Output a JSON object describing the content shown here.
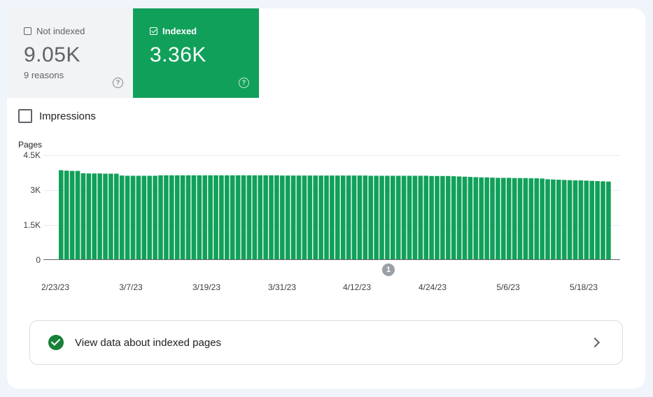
{
  "tiles": {
    "not_indexed": {
      "label": "Not indexed",
      "value": "9.05K",
      "sub": "9 reasons",
      "checked": false,
      "help": "?"
    },
    "indexed": {
      "label": "Indexed",
      "value": "3.36K",
      "checked": true,
      "help": "?"
    }
  },
  "impressions": {
    "label": "Impressions",
    "checked": false
  },
  "colors": {
    "indexed": "#11a05a",
    "bars": "#11a05a",
    "not_indexed_bg": "#f1f3f4",
    "page_bg": "#f0f4fb"
  },
  "chart_data": {
    "type": "bar",
    "ylabel": "Pages",
    "ylim": [
      0,
      4500
    ],
    "yticks": [
      "4.5K",
      "3K",
      "1.5K",
      "0"
    ],
    "yvalues": [
      4500,
      3000,
      1500,
      0
    ],
    "xticks": [
      "2/23/23",
      "3/7/23",
      "3/19/23",
      "3/31/23",
      "4/12/23",
      "4/24/23",
      "5/6/23",
      "5/18/23"
    ],
    "start_date": "2/23/23",
    "grid": true,
    "annotation": {
      "label": "1",
      "date": "4/14/23"
    },
    "values": [
      3850,
      3830,
      3820,
      3820,
      3720,
      3710,
      3710,
      3710,
      3700,
      3700,
      3700,
      3620,
      3610,
      3610,
      3610,
      3610,
      3610,
      3610,
      3630,
      3630,
      3630,
      3630,
      3630,
      3630,
      3630,
      3630,
      3630,
      3630,
      3630,
      3630,
      3630,
      3630,
      3630,
      3630,
      3630,
      3630,
      3630,
      3630,
      3630,
      3630,
      3620,
      3620,
      3620,
      3620,
      3620,
      3620,
      3620,
      3620,
      3620,
      3620,
      3620,
      3620,
      3620,
      3620,
      3620,
      3620,
      3610,
      3610,
      3610,
      3610,
      3610,
      3610,
      3610,
      3610,
      3610,
      3610,
      3610,
      3600,
      3600,
      3600,
      3600,
      3590,
      3580,
      3570,
      3560,
      3550,
      3540,
      3540,
      3530,
      3520,
      3520,
      3520,
      3510,
      3510,
      3510,
      3500,
      3500,
      3490,
      3460,
      3450,
      3440,
      3430,
      3420,
      3410,
      3410,
      3400,
      3390,
      3380,
      3370,
      3360
    ]
  },
  "link": {
    "text": "View data about indexed pages"
  }
}
